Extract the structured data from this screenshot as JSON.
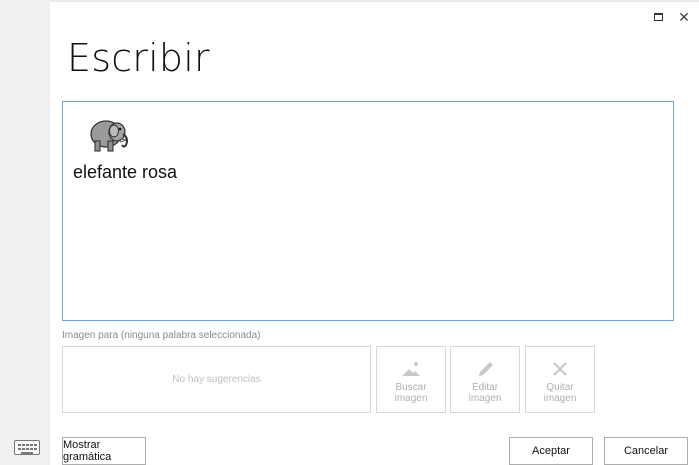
{
  "window": {
    "title": "Escribir",
    "maximize_icon": "maximize-icon",
    "close_icon": "close-icon",
    "close_glyph": "✕"
  },
  "editor": {
    "word": {
      "icon": "elephant-icon",
      "text": "elefante rosa"
    }
  },
  "image_panel": {
    "caption": "Imagen para (ninguna palabra seleccionada)",
    "suggestions_empty": "No hay sugerencias",
    "buttons": [
      {
        "icon": "image-search-icon",
        "line1": "Buscar",
        "line2": "imagen"
      },
      {
        "icon": "pencil-icon",
        "line1": "Editar",
        "line2": "imagen"
      },
      {
        "icon": "remove-x-icon",
        "line1": "Quitar",
        "line2": "imagen"
      }
    ]
  },
  "footer": {
    "keyboard_icon": "keyboard-icon",
    "grammar_label": "Mostrar gramática",
    "ok_label": "Aceptar",
    "cancel_label": "Cancelar"
  }
}
